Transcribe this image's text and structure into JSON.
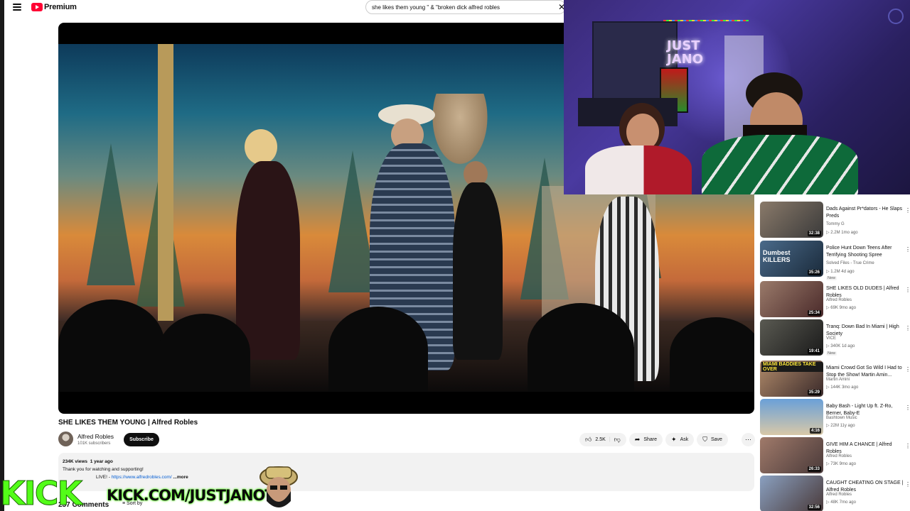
{
  "brand": {
    "name": "Premium"
  },
  "search": {
    "query": "she likes them young \" & \"broken dick  alfred robles"
  },
  "video": {
    "title": "SHE LIKES THEM YOUNG | Alfred Robles",
    "channel": "Alfred Robles",
    "subscribers": "101K subscribers",
    "subscribe_label": "Subscribe",
    "likes": "2.5K",
    "share_label": "Share",
    "ask_label": "Ask",
    "save_label": "Save",
    "views": "234K views",
    "age": "1 year ago",
    "description_line": "Thank you for watching and supporting!",
    "description_prefix": "LIVE! -",
    "description_link": "https://www.alfredrobles.com/",
    "more_label": "...more",
    "comments_count": "237 Comments",
    "sort_label": "Sort by"
  },
  "overlay": {
    "kick_logo": "KICK",
    "kick_url": "KICK.COM/JUSTJANOTV",
    "neon_sign": "JUST JANO"
  },
  "recommendations": [
    {
      "title": "Dads Against Pr*dators - He Slaps Preds",
      "channel": "Tommy G",
      "meta": "▷ 2.2M  1mo ago",
      "duration": "32:38",
      "badge": ""
    },
    {
      "title": "Police Hunt Down Teens After Terrifying Shooting Spree",
      "channel": "Solved Files - True Crime",
      "meta": "▷ 1.2M  4d ago",
      "duration": "35:26",
      "badge": "New"
    },
    {
      "title": "SHE LIKES OLD DUDES | Alfred Robles",
      "channel": "Alfred Robles",
      "meta": "▷ 69K  9mo ago",
      "duration": "25:34",
      "badge": ""
    },
    {
      "title": "Tranq: Down Bad In Miami | High Society",
      "channel": "VICE",
      "meta": "▷ 340K  1d ago",
      "duration": "19:41",
      "badge": "New"
    },
    {
      "title": "Miami Crowd Got So Wild I Had to Stop the Show! Martin Amin...",
      "channel": "Martin Amini",
      "meta": "▷ 144K  3mo ago",
      "duration": "35:29",
      "badge": ""
    },
    {
      "title": "Baby Bash - Light Up ft. Z-Ro, Berner, Baby-E",
      "channel": "Bashtown Music",
      "meta": "▷ 22M  11y ago",
      "duration": "4:16",
      "badge": ""
    },
    {
      "title": "GIVE HIM A CHANCE | Alfred Robles",
      "channel": "Alfred Robles",
      "meta": "▷ 73K  9mo ago",
      "duration": "26:33",
      "badge": ""
    },
    {
      "title": "CAUGHT CHEATING ON STAGE | Alfred Robles",
      "channel": "Alfred Robles",
      "meta": "▷ 48K  7mo ago",
      "duration": "32:56",
      "badge": ""
    }
  ],
  "thumb_colors": [
    "#6a5a52",
    "#3a4a5a",
    "#7a5a4a",
    "#4a4a44",
    "#8a6a5a",
    "#5a8ab0",
    "#8a6a62",
    "#7a8aa0"
  ],
  "thumb_overlays": [
    "",
    "Dumbest KILLERS",
    "",
    "",
    "MIAMI BADDIES TAKE OVER",
    "",
    "",
    ""
  ]
}
